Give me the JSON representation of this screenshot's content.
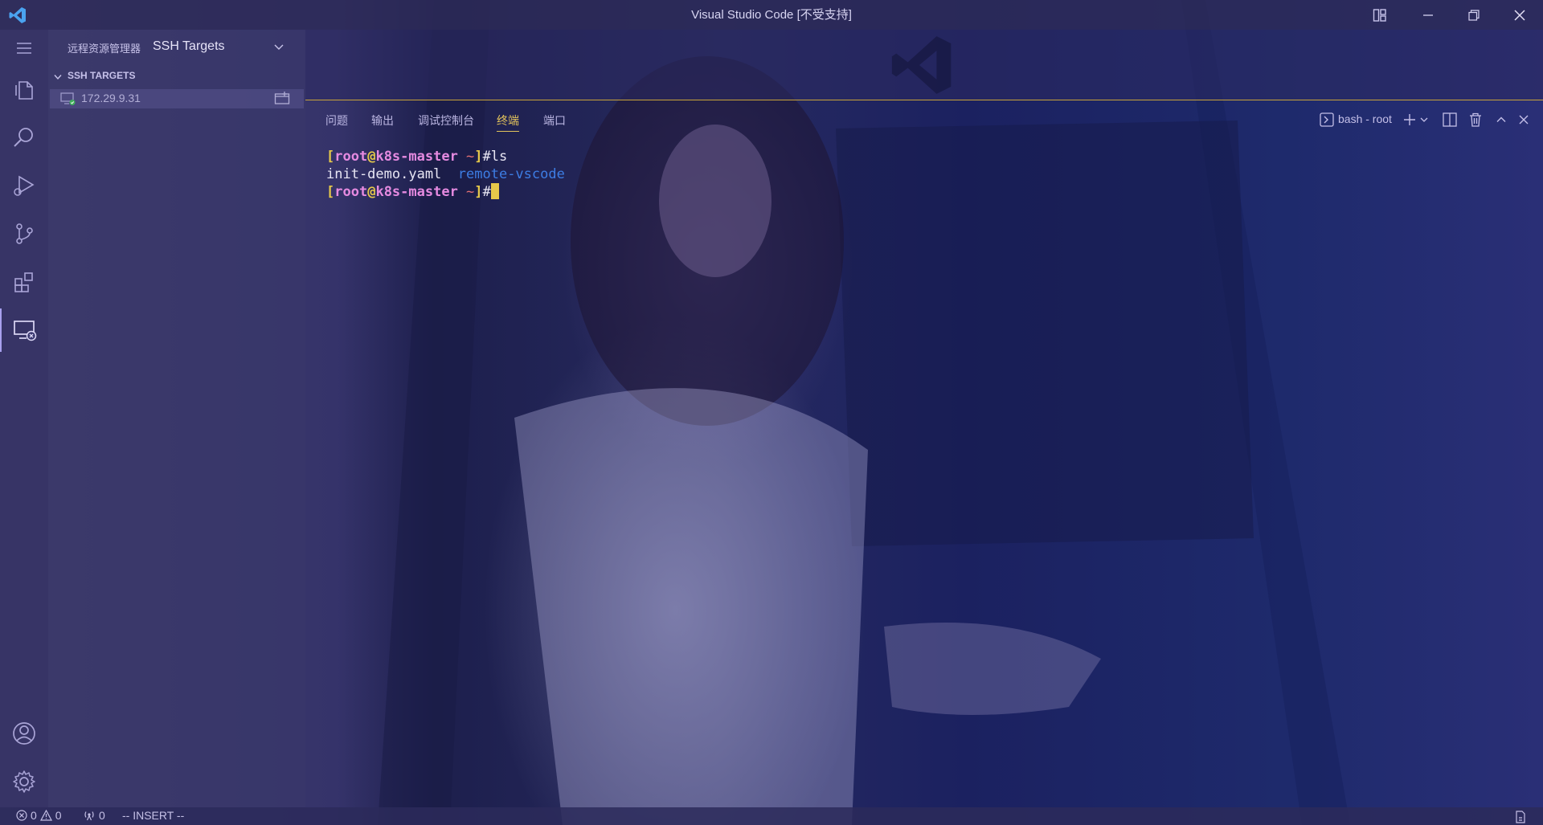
{
  "window": {
    "title": "Visual Studio Code [不受支持]"
  },
  "sidebar": {
    "title": "远程资源管理器",
    "selected_target": "SSH Targets",
    "section_title": "SSH TARGETS",
    "hosts": [
      {
        "label": "172.29.9.31"
      }
    ]
  },
  "activity_bar": {
    "items": [
      "menu-icon",
      "explorer-icon",
      "search-icon",
      "run-debug-icon",
      "source-control-icon",
      "extensions-icon",
      "remote-explorer-icon"
    ],
    "bottom": [
      "account-icon",
      "settings-gear-icon"
    ]
  },
  "panel": {
    "tabs": [
      {
        "label": "问题"
      },
      {
        "label": "输出"
      },
      {
        "label": "调试控制台"
      },
      {
        "label": "终端"
      },
      {
        "label": "端口"
      }
    ],
    "active_tab": "终端",
    "terminal_name": "bash - root"
  },
  "terminal": {
    "prompt": {
      "open": "[",
      "user": "root",
      "at": "@",
      "host": "k8s-master",
      "path": " ~",
      "close": "]",
      "symbol": "#"
    },
    "command": "ls",
    "output": {
      "file": "init-demo.yaml",
      "dir": "remote-vscode"
    }
  },
  "statusbar": {
    "errors": "0",
    "warnings": "0",
    "ports": "0",
    "mode": "-- INSERT --"
  },
  "colors": {
    "accent": "#e2c35c",
    "prompt_bracket": "#e6c94a",
    "prompt_user": "#e58ae0",
    "directory": "#3d7de4"
  }
}
